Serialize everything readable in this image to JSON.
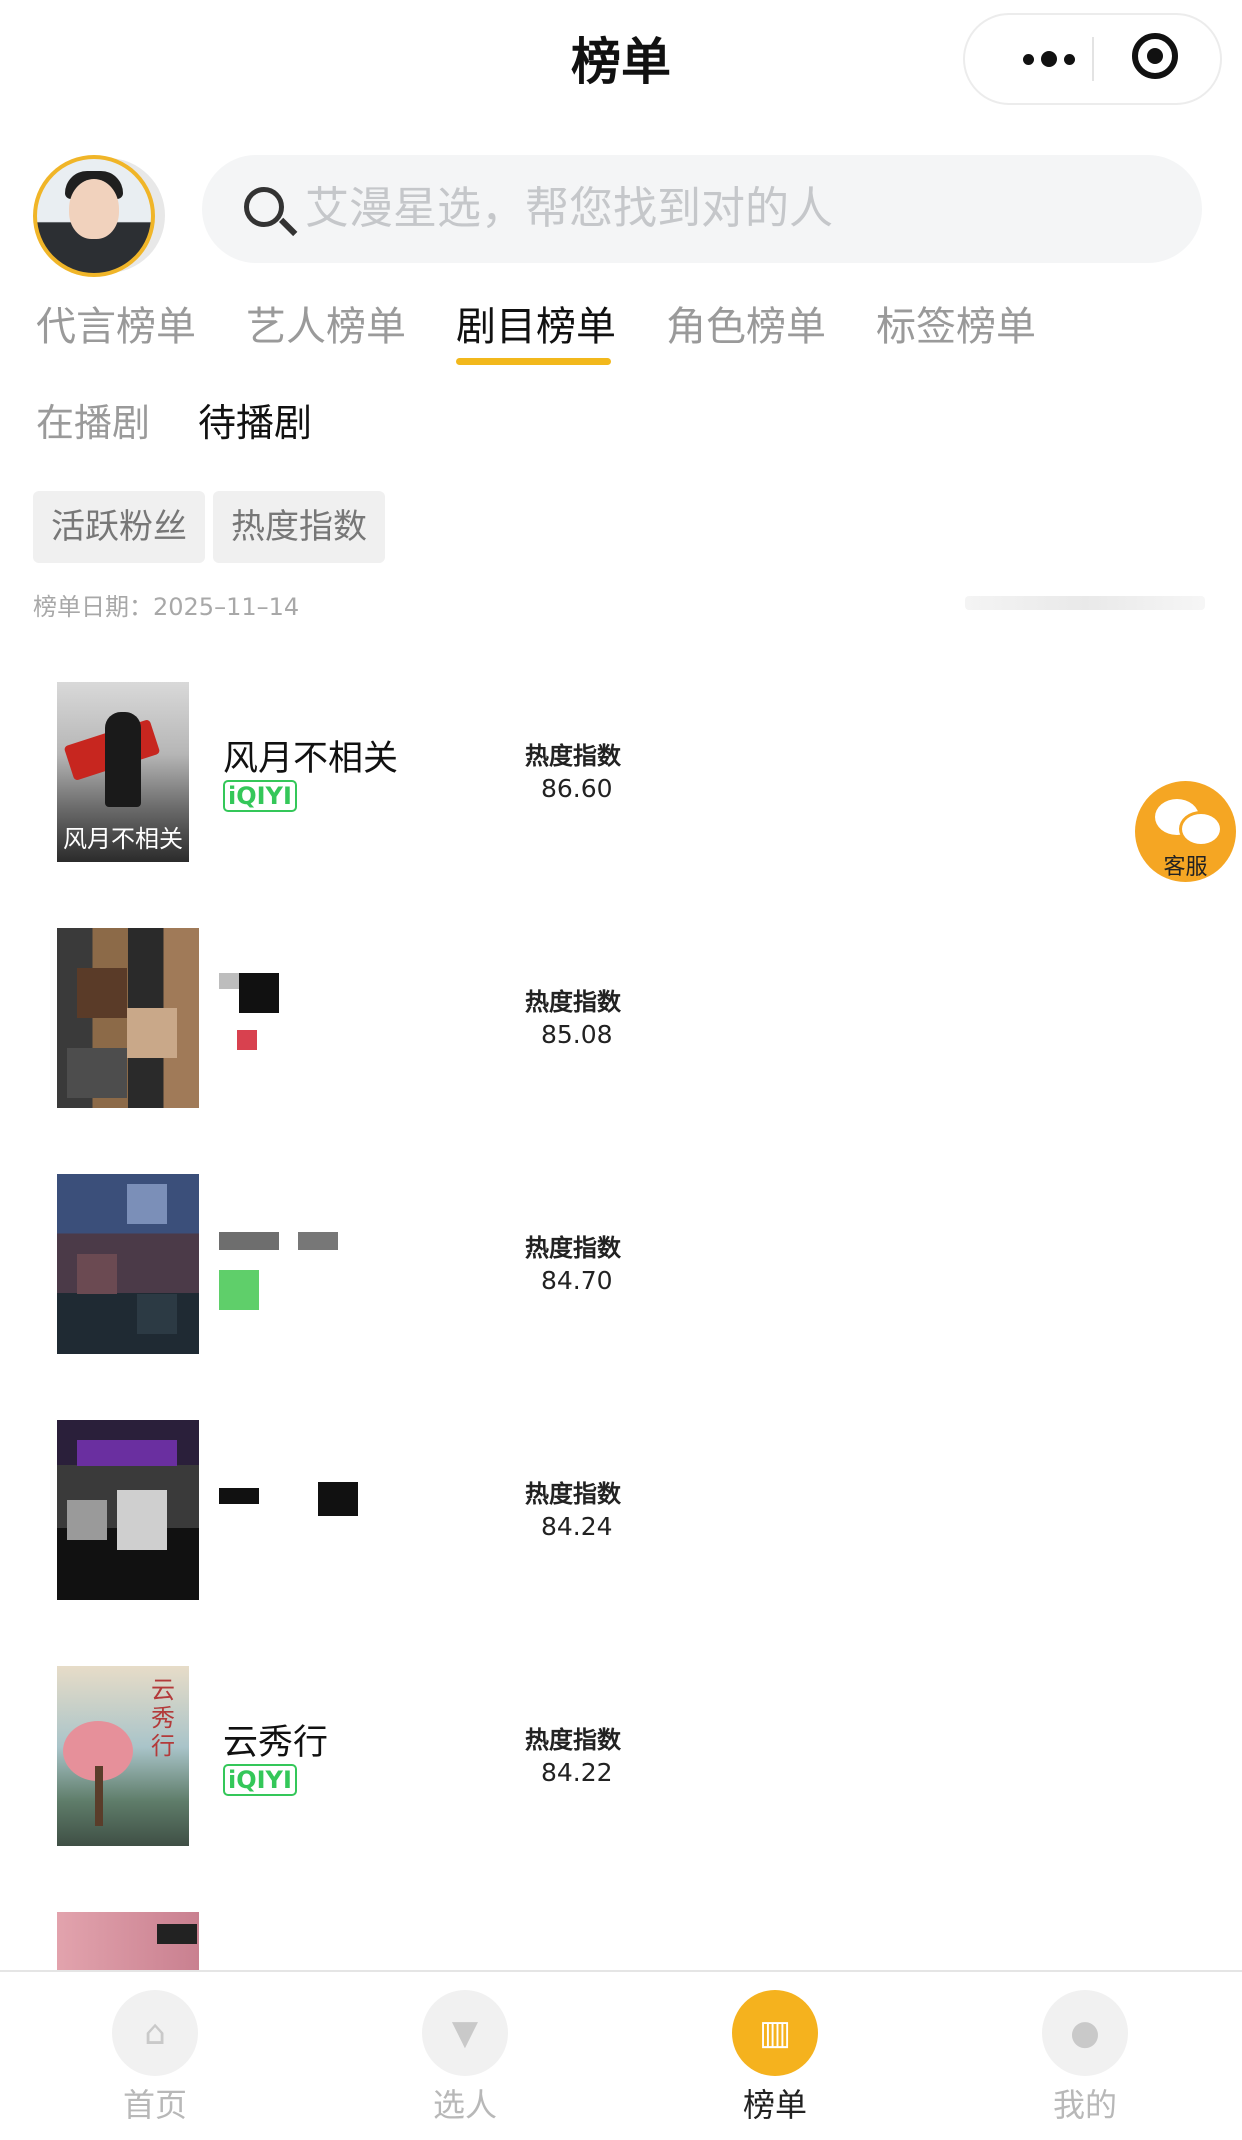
{
  "header": {
    "title": "榜单"
  },
  "search": {
    "placeholder": "艾漫星选，帮您找到对的人"
  },
  "tabs": [
    "代言榜单",
    "艺人榜单",
    "剧目榜单",
    "角色榜单",
    "标签榜单"
  ],
  "active_tab": "剧目榜单",
  "subtabs": [
    "在播剧",
    "待播剧"
  ],
  "active_subtab": "待播剧",
  "filters": [
    "活跃粉丝",
    "热度指数"
  ],
  "date_label": "榜单日期：2025–11–14",
  "list": [
    {
      "title": "风月不相关",
      "platform": "iQIYI",
      "metric_label": "热度指数",
      "metric_value": "86.60",
      "poster_text": "风月不相关"
    },
    {
      "title": "",
      "platform": "",
      "metric_label": "热度指数",
      "metric_value": "85.08"
    },
    {
      "title": "",
      "platform": "",
      "metric_label": "热度指数",
      "metric_value": "84.70"
    },
    {
      "title": "",
      "platform": "",
      "metric_label": "热度指数",
      "metric_value": "84.24"
    },
    {
      "title": "云秀行",
      "platform": "iQIYI",
      "metric_label": "热度指数",
      "metric_value": "84.22",
      "poster_text": "云秀行"
    }
  ],
  "service": {
    "label": "客服"
  },
  "bottom_nav": [
    "首页",
    "选人",
    "榜单",
    "我的"
  ],
  "colors": {
    "accent": "#f5b21e",
    "platform": "#34c759"
  },
  "icons": {
    "more": "more-dots-icon",
    "target": "target-icon",
    "search": "search-icon",
    "service": "wechat-icon"
  }
}
